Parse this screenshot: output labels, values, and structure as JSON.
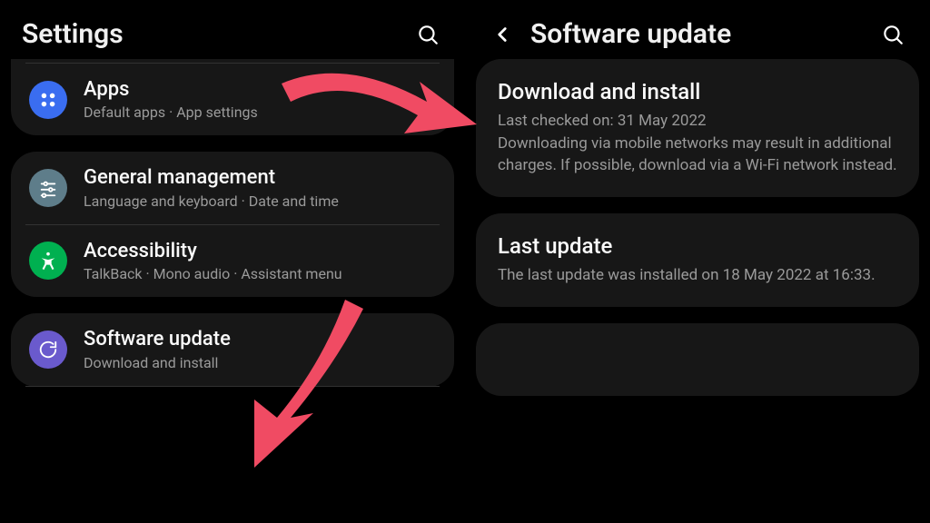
{
  "left": {
    "title": "Settings",
    "groups": [
      [
        {
          "icon": "apps",
          "label": "Apps",
          "sub": "Default apps · App settings"
        }
      ],
      [
        {
          "icon": "general",
          "label": "General management",
          "sub": "Language and keyboard · Date and time"
        },
        {
          "icon": "access",
          "label": "Accessibility",
          "sub": "TalkBack · Mono audio · Assistant menu"
        }
      ],
      [
        {
          "icon": "update",
          "label": "Software update",
          "sub": "Download and install"
        }
      ]
    ]
  },
  "right": {
    "title": "Software update",
    "sections": [
      {
        "label": "Download and install",
        "sub": "Last checked on: 31 May 2022\nDownloading via mobile networks may result in additional charges. If possible, download via a Wi-Fi network instead."
      },
      {
        "label": "Last update",
        "sub": "The last update was installed on 18 May 2022 at 16:33."
      }
    ]
  },
  "arrow_color": "#f04b63"
}
